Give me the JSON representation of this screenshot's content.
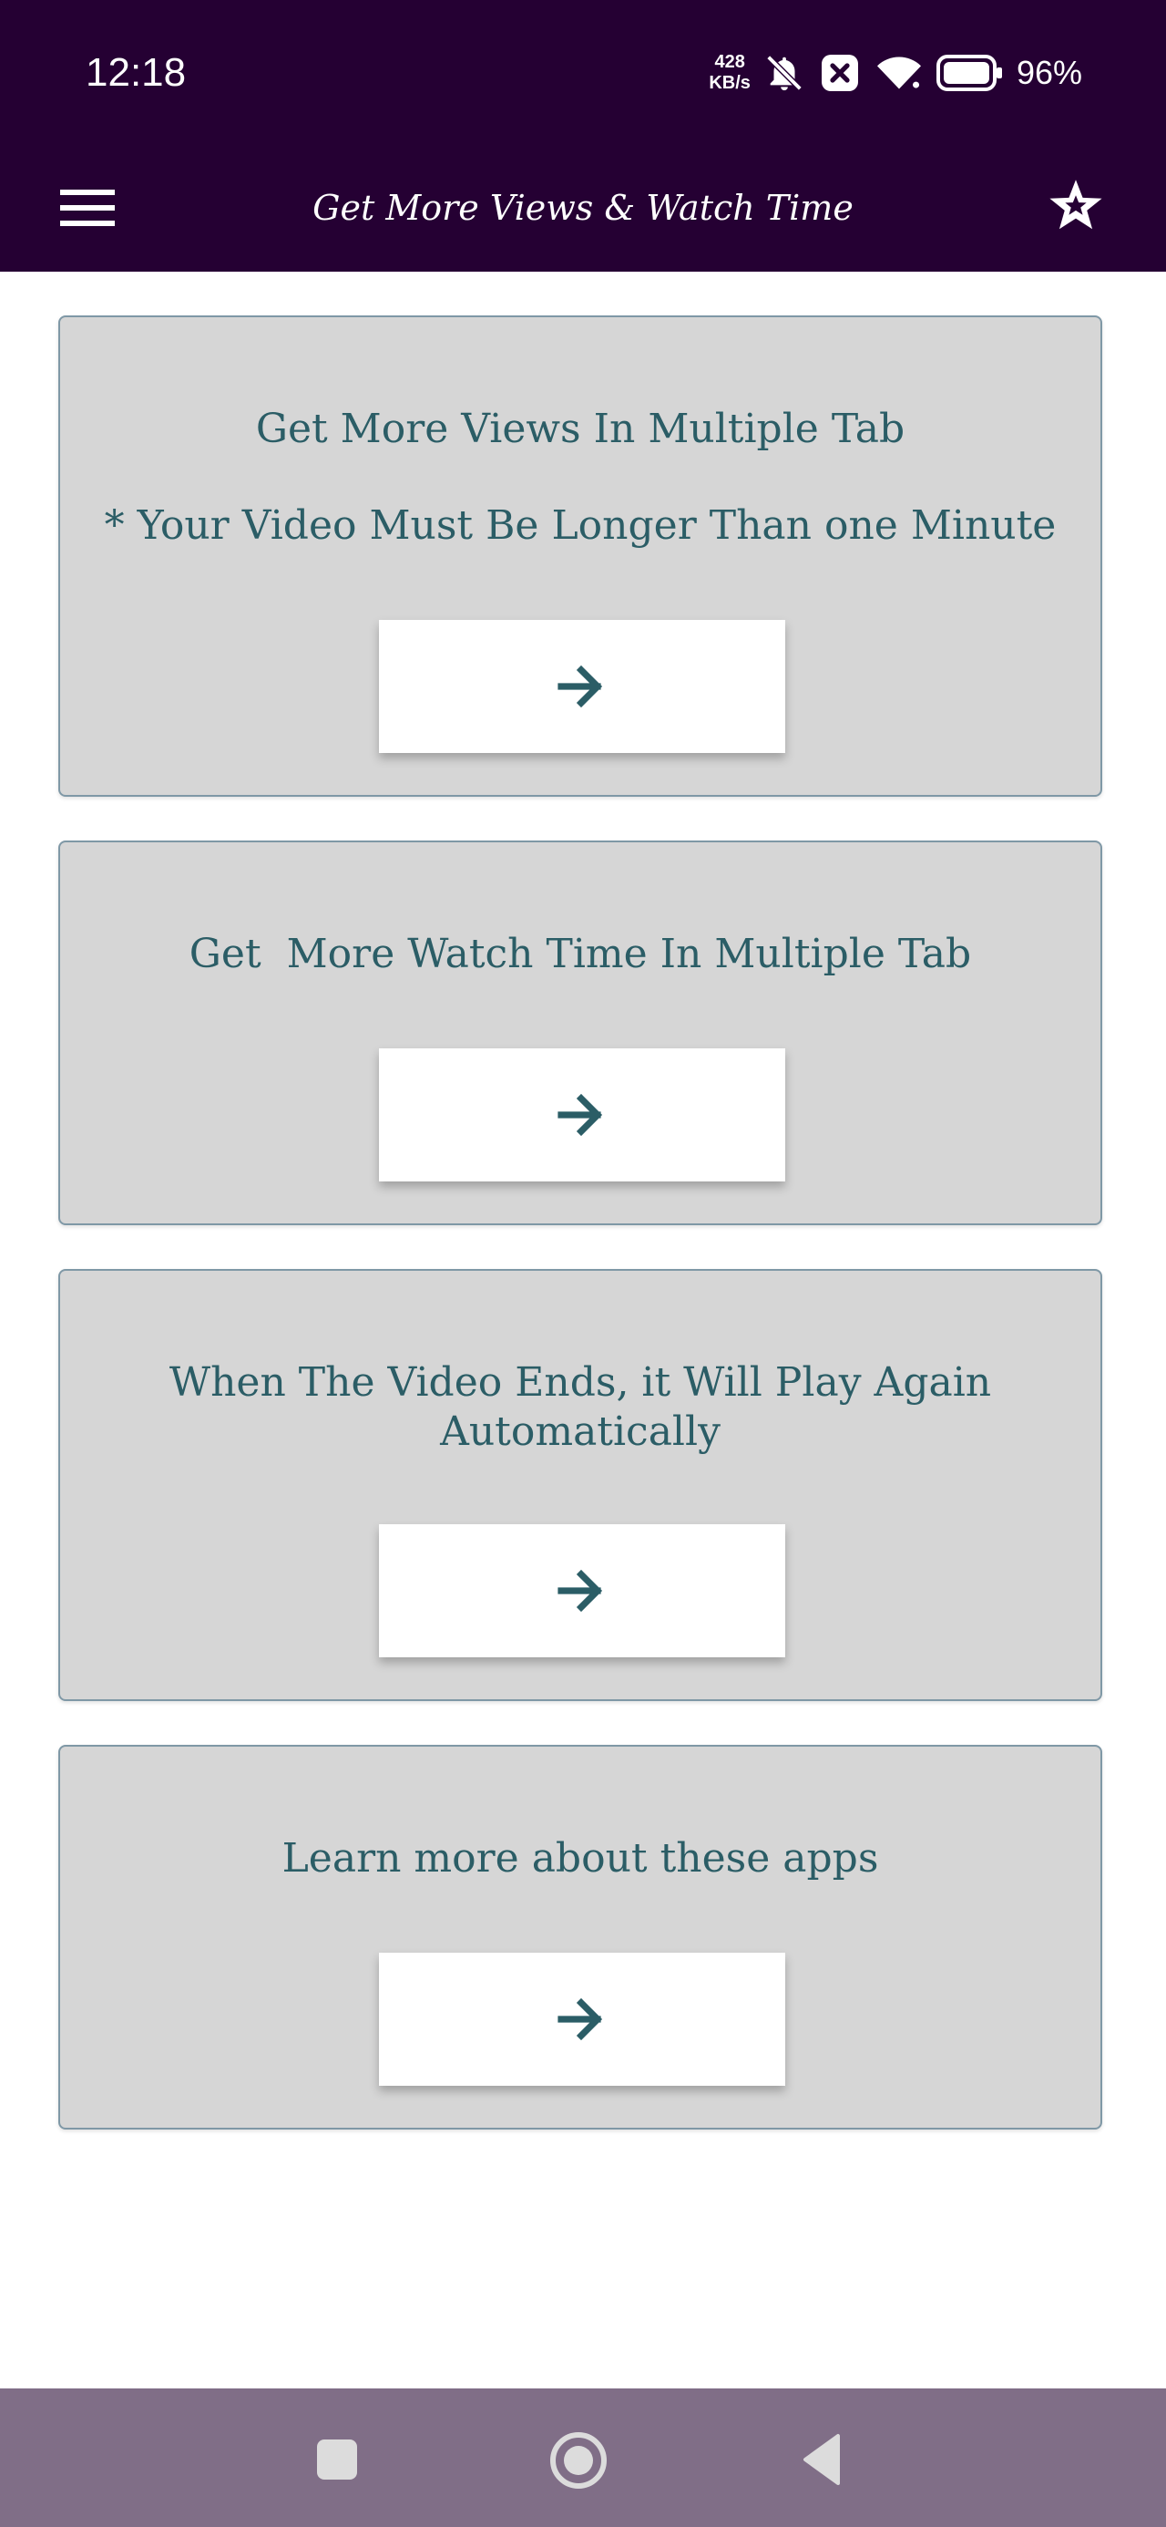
{
  "status_bar": {
    "time": "12:18",
    "net_speed_value": "428",
    "net_speed_unit": "KB/s",
    "battery_percent": "96%",
    "icons": [
      "bell-off-icon",
      "close-box-icon",
      "wifi-icon",
      "battery-icon"
    ]
  },
  "app_bar": {
    "title": "Get More Views & Watch Time",
    "menu_icon": "hamburger-menu-icon",
    "favorite_icon": "star-icon"
  },
  "colors": {
    "bar_background": "#250033",
    "card_background": "#d6d6d6",
    "card_text": "#2b5d66",
    "nav_background": "#806e87"
  },
  "cards": [
    {
      "line1": "Get More Views In Multiple Tab",
      "line2": "* Your Video Must Be Longer Than one Minute",
      "button_icon": "arrow-right-icon"
    },
    {
      "line1": "Get  More Watch Time In Multiple Tab",
      "button_icon": "arrow-right-icon"
    },
    {
      "line1": "When The Video Ends, it Will Play Again",
      "line2": "Automatically",
      "button_icon": "arrow-right-icon"
    },
    {
      "line1": "Learn more about these apps",
      "button_icon": "arrow-right-icon"
    }
  ],
  "nav_bar": {
    "buttons": [
      "recents-square-icon",
      "home-circle-icon",
      "back-triangle-icon"
    ]
  }
}
